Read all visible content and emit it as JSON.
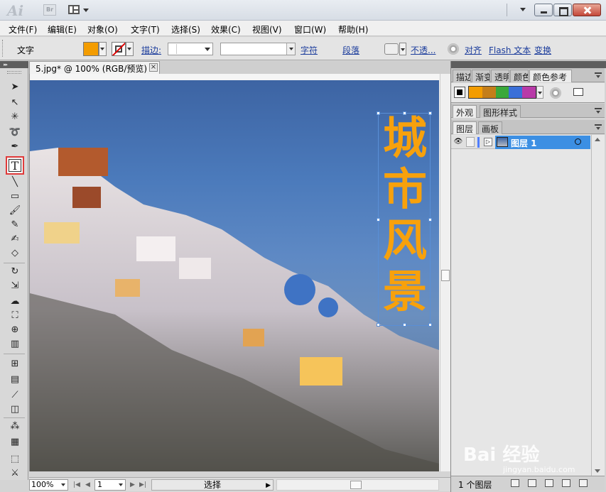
{
  "titlebar": {
    "app_logo": "Ai",
    "bridge": "Br"
  },
  "menu": {
    "items": [
      "文件(F)",
      "编辑(E)",
      "对象(O)",
      "文字(T)",
      "选择(S)",
      "效果(C)",
      "视图(V)",
      "窗口(W)",
      "帮助(H)"
    ]
  },
  "control_bar": {
    "tool_label": "文字",
    "fill_color": "#f39c00",
    "stroke_label": "描边:",
    "char_label": "字符",
    "para_label": "段落",
    "transparency_label": "不透...",
    "align_label": "对齐",
    "flash_label": "Flash 文本",
    "transform_label": "变换"
  },
  "document": {
    "tab_title": "5.jpg* @ 100% (RGB/预览)",
    "tab_close": "×",
    "vertical_text": [
      "城",
      "市",
      "风",
      "景"
    ],
    "text_color": "#f7a10c",
    "sky_color": "#4b7abb"
  },
  "status": {
    "zoom": "100%",
    "page": "1",
    "text": "选择"
  },
  "panels": {
    "color_guide_tabs": [
      "描边",
      "渐变",
      "透明",
      "颜色",
      "颜色参考"
    ],
    "color_guide_swatches": [
      "#f39c00",
      "#c47e1a",
      "#3aa83a",
      "#3a6fd8",
      "#b83aa8"
    ],
    "appearance_tabs": [
      "外观",
      "图形样式"
    ],
    "layers_tabs": [
      "图层",
      "画板"
    ],
    "layer_name": "图层 1",
    "layers_count": "1 个图层"
  },
  "watermark": {
    "brand": "Bai 经验",
    "url": "jingyan.baidu.com"
  }
}
